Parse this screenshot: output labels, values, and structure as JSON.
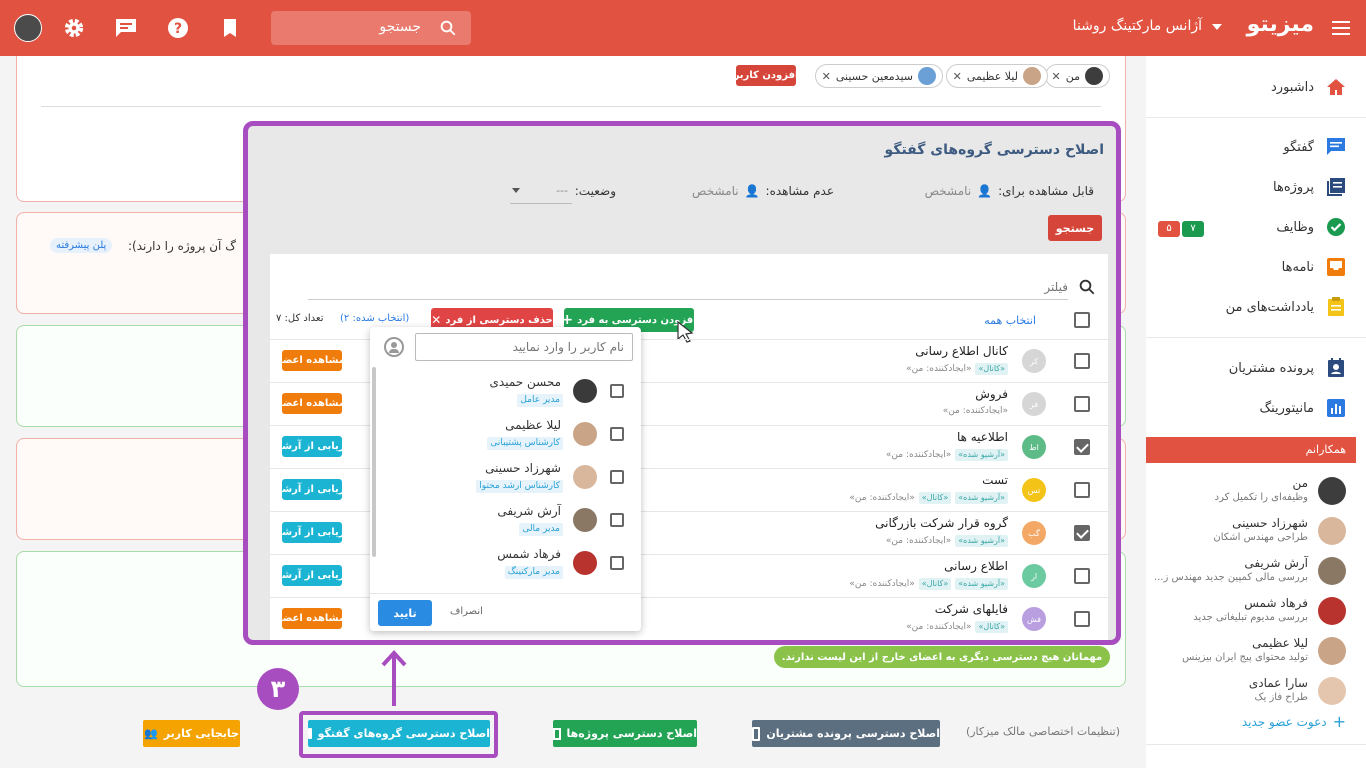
{
  "topbar": {
    "logo": "میزیتو",
    "agency": "آژانس مارکتینگ روشنا",
    "search_placeholder": "جستجو"
  },
  "sidebar": {
    "items": [
      {
        "label": "داشبورد",
        "icon": "home-icon"
      },
      {
        "label": "گفتگو",
        "icon": "chat-icon"
      },
      {
        "label": "پروژه‌ها",
        "icon": "projects-icon"
      },
      {
        "label": "وظایف",
        "icon": "tasks-icon"
      },
      {
        "label": "نامه‌ها",
        "icon": "inbox-icon"
      },
      {
        "label": "یادداشت‌های من",
        "icon": "notes-icon"
      },
      {
        "label": "پرونده مشتریان",
        "icon": "contacts-icon"
      },
      {
        "label": "مانیتورینگ",
        "icon": "chart-icon"
      }
    ],
    "task_badges": {
      "green": "۷",
      "red": "۵"
    },
    "colleagues_header": "همکارانم",
    "colleagues": [
      {
        "name": "من",
        "desc": "وظیفه‌ای را تکمیل کرد"
      },
      {
        "name": "شهرزاد حسینی",
        "desc": "طراحی مهندس اشکان"
      },
      {
        "name": "آرش شریفی",
        "desc": "بررسی مالی کمپین جدید مهندس ز..."
      },
      {
        "name": "فرهاد شمس",
        "desc": "بررسی مدیوم تبلیغاتی جدید"
      },
      {
        "name": "لیلا عظیمی",
        "desc": "تولید محتوای پیج ایران بیزینس"
      },
      {
        "name": "سارا عمادی",
        "desc": "طراح فاز یک"
      }
    ],
    "invite": "دعوت عضو جدید"
  },
  "background": {
    "chips": [
      "من",
      "لیلا عظیمی",
      "سیدمعین حسینی"
    ],
    "add_user": "افزودن کاربر",
    "partial_text": "گ آن پروژه را دارند):",
    "advanced_plan": "پلن پیشرفته",
    "guests_notice": "مهمانان هیچ دسترسی دیگری به اعضای خارج از این لیست ندارند."
  },
  "dialog": {
    "title": "اصلاح دسترسی گروه‌های گفتگو",
    "visible_to_label": "قابل مشاهده برای:",
    "visible_to_value": "نامشخص",
    "not_visible_label": "عدم مشاهده:",
    "not_visible_value": "نامشخص",
    "status_label": "وضعیت:",
    "status_value": "---",
    "search_button": "جستجو",
    "filter_placeholder": "فیلتر",
    "select_all": "انتخاب همه",
    "add_access": "افزودن دسترسی به فرد",
    "remove_access": "حذف دسترسی از فرد",
    "selected_count": "(انتخاب شده: ۲)",
    "total_count": "تعداد کل: ۷",
    "rows": [
      {
        "initials": "کر",
        "name": "کانال اطلاع رسانی",
        "creator": "«ایجادکننده: من»",
        "tags": [
          "«کانال»"
        ],
        "checked": false,
        "action": "مشاهده اعضا",
        "action_color": "#f07c0b",
        "avatar_color": "#d6d6d6"
      },
      {
        "initials": "فر",
        "name": "فروش",
        "creator": "«ایجادکننده: من»",
        "tags": [],
        "checked": false,
        "action": "مشاهده اعضا",
        "action_color": "#f07c0b",
        "avatar_color": "#d6d6d6"
      },
      {
        "initials": "اط",
        "name": "اطلاعیه ها",
        "creator": "«ایجادکننده: من»",
        "tags": [
          "«آرشیو شده»"
        ],
        "checked": true,
        "action": "بازیابی از آرشیو",
        "action_color": "#1bb5d3",
        "avatar_color": "#5dbb88"
      },
      {
        "initials": "تس",
        "name": "تست",
        "creator": "«ایجادکننده: من»",
        "tags": [
          "«کانال»",
          "«آرشیو شده»"
        ],
        "checked": false,
        "action": "بازیابی از آرشیو",
        "action_color": "#1bb5d3",
        "avatar_color": "#f3c417"
      },
      {
        "initials": "گب",
        "name": "گروه قرار شرکت بازرگانی",
        "creator": "«ایجادکننده: من»",
        "tags": [
          "«آرشیو شده»"
        ],
        "checked": true,
        "action": "بازیابی از آرشیو",
        "action_color": "#1bb5d3",
        "avatar_color": "#f3a866"
      },
      {
        "initials": "ار",
        "name": "اطلاع رسانی",
        "creator": "«ایجادکننده: من»",
        "tags": [
          "«کانال»",
          "«آرشیو شده»"
        ],
        "checked": false,
        "action": "بازیابی از آرشیو",
        "action_color": "#1bb5d3",
        "avatar_color": "#6ccaa0"
      },
      {
        "initials": "فش",
        "name": "فایلهای شرکت",
        "creator": "«ایجادکننده: من»",
        "tags": [
          "«کانال»"
        ],
        "checked": false,
        "action": "مشاهده اعضا",
        "action_color": "#f07c0b",
        "avatar_color": "#b99ee0"
      }
    ]
  },
  "dropdown": {
    "placeholder": "نام کاربر را وارد نمایید",
    "users": [
      {
        "name": "محسن حمیدی",
        "role": "مدیر عامل"
      },
      {
        "name": "لیلا عظیمی",
        "role": "کارشناس پشتیبانی"
      },
      {
        "name": "شهرزاد حسینی",
        "role": "کارشناس ارشد محتوا"
      },
      {
        "name": "آرش شریفی",
        "role": "مدیر مالی"
      },
      {
        "name": "فرهاد شمس",
        "role": "مدیر مارکتینگ"
      }
    ],
    "confirm": "تایید",
    "cancel": "انصراف"
  },
  "bottom": {
    "owner_settings": "(تنظیمات اختصاصی مالک میزکار)",
    "contacts_access": "اصلاح دسترسی پرونده مشتریان",
    "projects_access": "اصلاح دسترسی پروژه‌ها",
    "chat_groups_access": "اصلاح دسترسی گروه‌های گفتگو",
    "move_user": "جابجایی کاربر",
    "step_number": "۳"
  },
  "colors": {
    "brand": "#e15241",
    "highlight": "#a84dbf",
    "green": "#23a455",
    "teal": "#1bb5d3",
    "orange": "#f07c0b"
  }
}
